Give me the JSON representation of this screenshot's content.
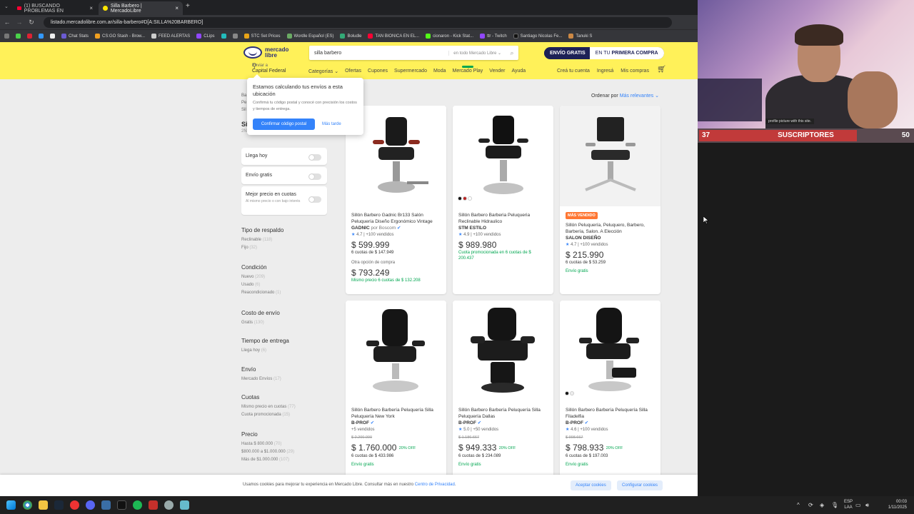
{
  "browser": {
    "tabs": [
      {
        "label": "(1) BUSCANDO PROBLEMAS EN",
        "active": false
      },
      {
        "label": "Silla Barbero | MercadoLibre",
        "active": true
      }
    ],
    "url": "listado.mercadolibre.com.ar/silla-barbero#D[A:SILLA%20BARBERO]",
    "bookmarks": [
      "Chat Stats",
      "CS:GO Stash - Brow...",
      "FEED ALERTAS",
      "CLips",
      "STC Set Prices",
      "Wordle Español (ES)",
      "Boludle",
      "TAN BIONICA EN EL...",
      "cionaron - Kick Stat...",
      "ttr - Twitch",
      "Santiago Nicolas Fe...",
      "Tanuki S"
    ]
  },
  "header": {
    "logo": "mercado libre",
    "search_value": "silla barbero",
    "search_scope": "en todo Mercado Libre",
    "promo_a": "ENVÍO GRATIS",
    "promo_b_prefix": "EN TU",
    "promo_b_bold": "PRIMERA COMPRA",
    "location_label": "Enviar a",
    "location_city": "Capital Federal",
    "nav": [
      "Categorías",
      "Ofertas",
      "Cupones",
      "Supermercado",
      "Moda",
      "Mercado Play",
      "Vender",
      "Ayuda"
    ],
    "user_nav": [
      "Creá tu cuenta",
      "Ingresá",
      "Mis compras"
    ]
  },
  "popup": {
    "title": "Estamos calculando tus envíos a esta ubicación",
    "body": "Confirmá tu código postal y conocé con precisión los costos y tiempos de entrega.",
    "confirm": "Confirmar código postal",
    "later": "Más tarde"
  },
  "sidebar": {
    "breadcrumb_lines": [
      "Ba",
      "Pe",
      "Sil"
    ],
    "title": "Si",
    "count": "2N",
    "toggles": [
      {
        "label": "Llega hoy",
        "sub": ""
      },
      {
        "label": "Envío gratis",
        "sub": ""
      },
      {
        "label": "Mejor precio en cuotas",
        "sub": "Al mismo precio o con bajo interés"
      }
    ],
    "filters": [
      {
        "title": "Tipo de respaldo",
        "items": [
          {
            "label": "Reclinable",
            "n": "(118)"
          },
          {
            "label": "Fijo",
            "n": "(32)"
          }
        ]
      },
      {
        "title": "Condición",
        "items": [
          {
            "label": "Nuevo",
            "n": "(209)"
          },
          {
            "label": "Usado",
            "n": "(6)"
          },
          {
            "label": "Reacondicionado",
            "n": "(1)"
          }
        ]
      },
      {
        "title": "Costo de envío",
        "items": [
          {
            "label": "Gratis",
            "n": "(130)"
          }
        ]
      },
      {
        "title": "Tiempo de entrega",
        "items": [
          {
            "label": "Llega hoy",
            "n": "(6)"
          }
        ]
      },
      {
        "title": "Envío",
        "items": [
          {
            "label": "Mercado Envíos",
            "n": "(17)"
          }
        ]
      },
      {
        "title": "Cuotas",
        "items": [
          {
            "label": "Mismo precio en cuotas",
            "n": "(77)"
          },
          {
            "label": "Cuota promocionada",
            "n": "(15)"
          }
        ]
      },
      {
        "title": "Precio",
        "items": [
          {
            "label": "Hasta $ 800.000",
            "n": "(70)"
          },
          {
            "label": "$800.000 a $1.000.000",
            "n": "(29)"
          },
          {
            "label": "Más de $1.000.000",
            "n": "(107)"
          }
        ]
      }
    ]
  },
  "results": {
    "sort_label": "Ordenar por",
    "sort_value": "Más relevantes",
    "cards": [
      {
        "badge": "",
        "title": "Sillón Barbero Gadnic Br133 Salón Peluquería Diseño Ergonómico Vintage",
        "brand": "GADNIC",
        "brand_by": "por Boscom",
        "rating": "4.7",
        "sold": "+100 vendidos",
        "old": "",
        "price": "$ 599.999",
        "off": "",
        "inst": "6 cuotas de $ 147.949",
        "green": "",
        "other_label": "Otra opción de compra",
        "other_price": "$ 793.249",
        "other_green": "Mismo precio 6 cuotas de $ 132.208"
      },
      {
        "badge": "",
        "title": "Sillón Barbero Barberia Peluqueria Reclinable Hidraulico",
        "brand": "STM ESTILO",
        "brand_by": "",
        "rating": "4.9",
        "sold": "+100 vendidos",
        "old": "",
        "price": "$ 989.980",
        "off": "",
        "inst": "",
        "green": "Cuota promocionada en 6 cuotas de $ 200.437",
        "other_label": "",
        "other_price": "",
        "other_green": ""
      },
      {
        "badge": "MÁS VENDIDO",
        "title": "Sillón Peluquería, Peluquero, Barbero, Barbería, Salon. A Elección",
        "brand": "SALON DISEÑO",
        "brand_by": "",
        "rating": "4.7",
        "sold": "+100 vendidos",
        "old": "",
        "price": "$ 215.990",
        "off": "",
        "inst": "6 cuotas de $ 53.259",
        "green": "Envío gratis",
        "other_label": "",
        "other_price": "",
        "other_green": ""
      },
      {
        "badge": "",
        "title": "Sillón Barbero Barbería Peluquería Silla Peluquería New York",
        "brand": "B-PROF",
        "brand_by": "",
        "rating": "",
        "sold": "+5 vendidos",
        "old": "$ 2.200.000",
        "price": "$ 1.760.000",
        "off": "20% OFF",
        "inst": "6 cuotas de $ 433.986",
        "green": "Envío gratis",
        "other_label": "",
        "other_price": "",
        "other_green": ""
      },
      {
        "badge": "",
        "title": "Sillón Barbero Barbería Peluquería Silla Peluquería Dallas",
        "brand": "B-PROF",
        "brand_by": "",
        "rating": "5.0",
        "sold": "+50 vendidos",
        "old": "$ 1.186.667",
        "price": "$ 949.333",
        "off": "20% OFF",
        "inst": "6 cuotas de $ 234.089",
        "green": "Envío gratis",
        "other_label": "",
        "other_price": "",
        "other_green": ""
      },
      {
        "badge": "",
        "title": "Sillón Barbero Barbería Peluquería Silla Filadelfia",
        "brand": "B-PROF",
        "brand_by": "",
        "rating": "4.6",
        "sold": "+100 vendidos",
        "old": "$ 998.667",
        "price": "$ 798.933",
        "off": "20% OFF",
        "inst": "6 cuotas de $ 197.003",
        "green": "Envío gratis",
        "other_label": "",
        "other_price": "",
        "other_green": ""
      }
    ]
  },
  "cookie": {
    "text": "Usamos cookies para mejorar tu experiencia en Mercado Libre. Consultar más en nuestro",
    "link": "Centro de Privacidad",
    "accept": "Aceptar cookies",
    "configure": "Configurar cookies"
  },
  "overlay": {
    "pip_text": "profile picture with this site.",
    "subs_current": "37",
    "subs_label": "SUSCRIPTORES",
    "subs_goal": "50",
    "subs_progress": 0.74
  },
  "taskbar": {
    "lang": "ESP",
    "lang2": "LAA",
    "time": "00:03",
    "date": "1/11/2025"
  },
  "colors": {
    "ml_yellow": "#fff159",
    "ml_blue": "#3483fa",
    "ml_green": "#00a650",
    "subs_red": "#c13a3a"
  }
}
